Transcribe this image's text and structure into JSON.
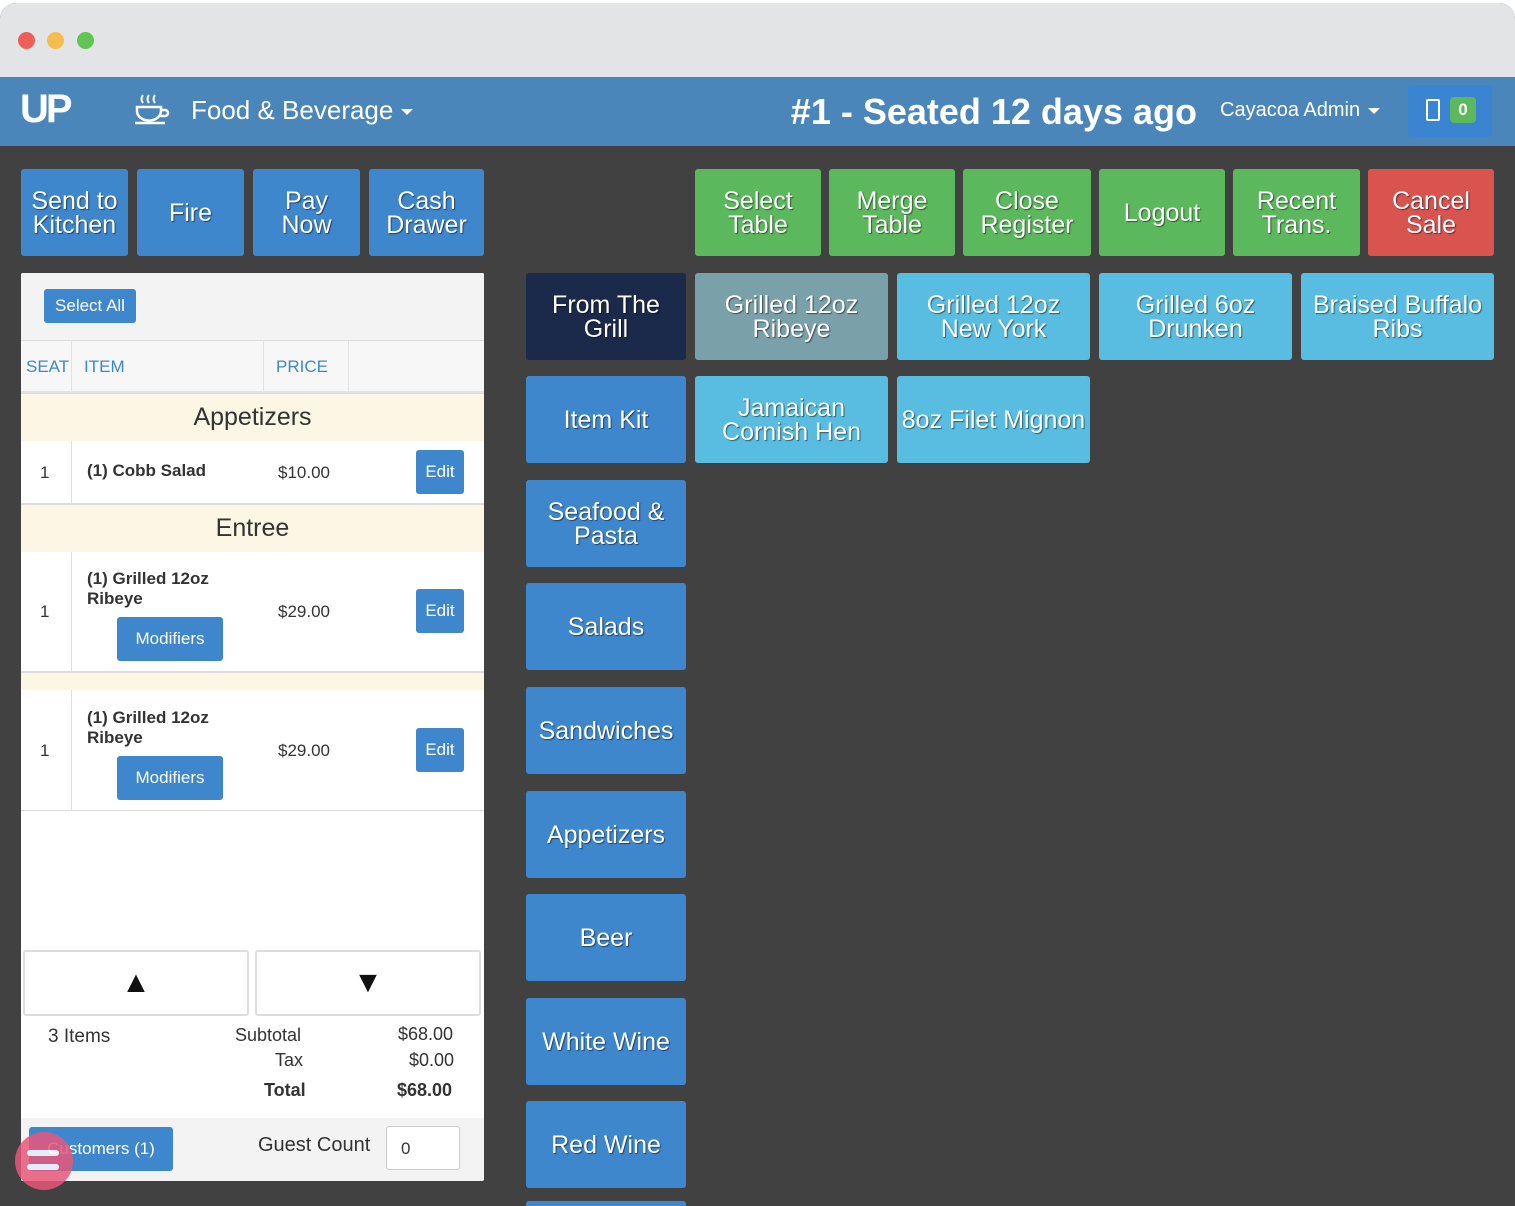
{
  "header": {
    "logo": "UP",
    "module": "Food & Beverage",
    "title": "#1 - Seated 12 days ago",
    "user": "Cayacoa Admin",
    "device_count": "0"
  },
  "actions": {
    "send_to_kitchen": "Send to Kitchen",
    "fire": "Fire",
    "pay_now": "Pay Now",
    "cash_drawer": "Cash Drawer",
    "select_table": "Select Table",
    "merge_table": "Merge Table",
    "close_register": "Close Register",
    "logout": "Logout",
    "recent_trans": "Recent Trans.",
    "cancel_sale": "Cancel Sale"
  },
  "order": {
    "select_all": "Select All",
    "columns": [
      "SEAT",
      "ITEM",
      "PRICE"
    ],
    "sections": [
      "Appetizers",
      "Entree"
    ],
    "rows": [
      {
        "seat": "1",
        "item": "(1) Cobb Salad",
        "price": "$10.00",
        "edit": "Edit"
      },
      {
        "seat": "1",
        "item": "(1) Grilled 12oz Ribeye",
        "price": "$29.00",
        "edit": "Edit",
        "modifiers": "Modifiers"
      },
      {
        "seat": "1",
        "item": "(1) Grilled 12oz Ribeye",
        "price": "$29.00",
        "edit": "Edit",
        "modifiers": "Modifiers"
      }
    ],
    "scroll_up": "▲",
    "scroll_down": "▼",
    "item_count": "3 Items",
    "subtotal_label": "Subtotal",
    "subtotal": "$68.00",
    "tax_label": "Tax",
    "tax": "$0.00",
    "total_label": "Total",
    "total": "$68.00",
    "customers": "Customers (1)",
    "guest_count_label": "Guest Count",
    "guest_count": "0"
  },
  "categories": [
    "From The Grill",
    "Item Kit",
    "Seafood & Pasta",
    "Salads",
    "Sandwiches",
    "Appetizers",
    "Beer",
    "White Wine",
    "Red Wine"
  ],
  "items": [
    "Grilled 12oz Ribeye",
    "Grilled 12oz New York",
    "Grilled 6oz Drunken",
    "Braised Buffalo Ribs",
    "Jamaican Cornish Hen",
    "8oz Filet Mignon"
  ],
  "colors": {
    "primary_blue": "#3f87cd",
    "header_blue": "#4a86b9",
    "green": "#5cb85c",
    "red": "#d9534f",
    "selected_category": "#1b2a4a",
    "selected_item": "#7aa0a9",
    "item_cyan": "#58bde0",
    "background": "#414141"
  }
}
